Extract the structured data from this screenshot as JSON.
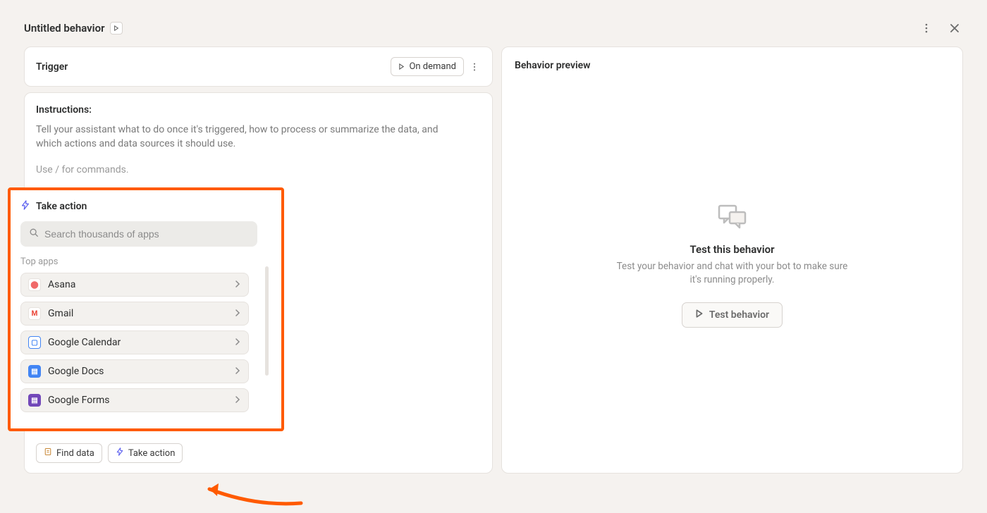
{
  "header": {
    "title": "Untitled behavior"
  },
  "trigger": {
    "label": "Trigger",
    "mode": "On demand"
  },
  "instructions": {
    "title": "Instructions:",
    "help": "Tell your assistant what to do once it's triggered, how to process or summarize the data, and which actions and data sources it should use.",
    "placeholder": "Use / for commands."
  },
  "popover": {
    "title": "Take action",
    "search_placeholder": "Search thousands of apps",
    "section": "Top apps",
    "apps": [
      {
        "name": "Asana"
      },
      {
        "name": "Gmail"
      },
      {
        "name": "Google Calendar"
      },
      {
        "name": "Google Docs"
      },
      {
        "name": "Google Forms"
      }
    ]
  },
  "bottom": {
    "find_data": "Find data",
    "take_action": "Take action"
  },
  "preview": {
    "panel_title": "Behavior preview",
    "heading": "Test this behavior",
    "sub": "Test your behavior and chat with your bot to make sure it's running properly.",
    "button": "Test behavior"
  }
}
